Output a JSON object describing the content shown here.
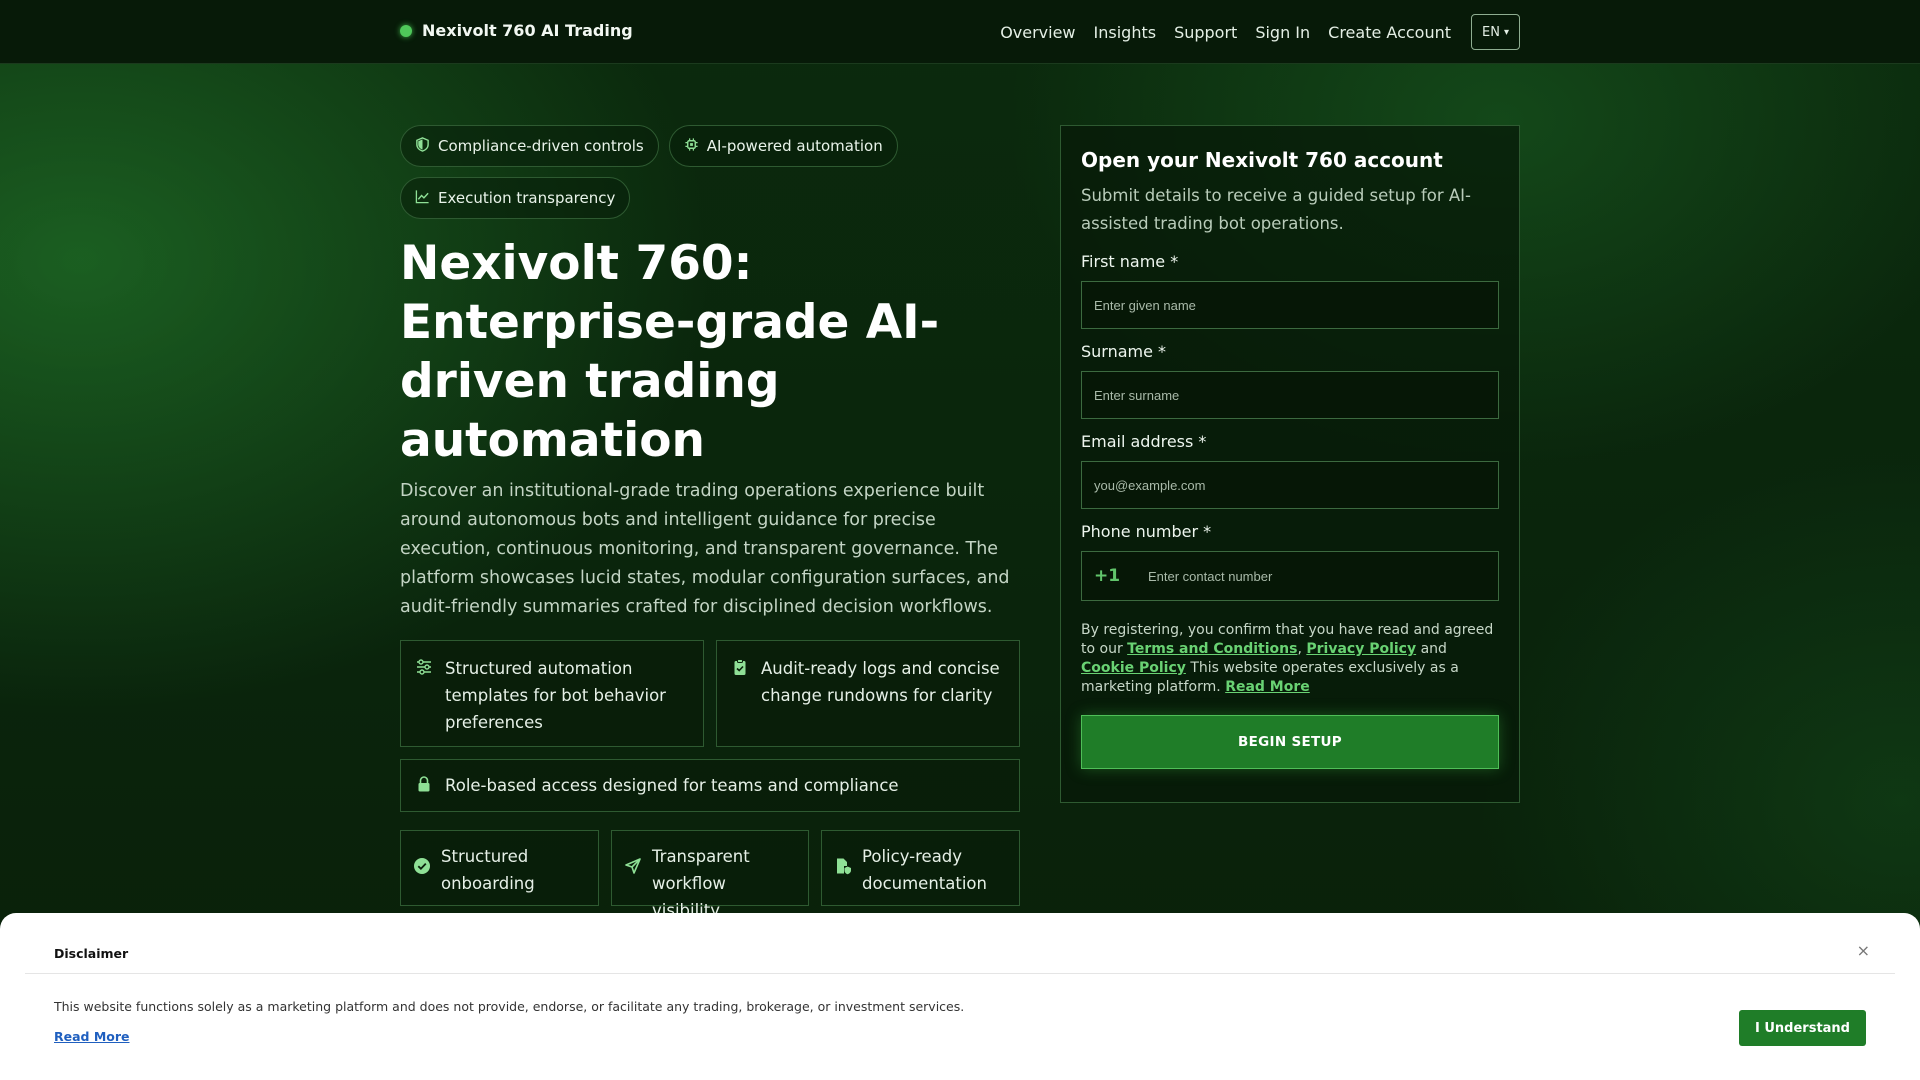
{
  "header": {
    "brand": "Nexivolt 760 AI Trading",
    "nav": [
      "Overview",
      "Insights",
      "Support",
      "Sign In",
      "Create Account"
    ],
    "language": "EN",
    "language_caret": "▾"
  },
  "hero": {
    "pills": [
      "Compliance-driven controls",
      "AI-powered automation",
      "Execution transparency"
    ],
    "title": "Nexivolt 760: Enterprise-grade AI-driven trading automation",
    "description": "Discover an institutional-grade trading operations experience built around autonomous bots and intelligent guidance for precise execution, continuous monitoring, and transparent governance. The platform showcases lucid states, modular configuration surfaces, and audit-friendly summaries crafted for disciplined decision workflows.",
    "features": [
      "Structured automation templates for bot behavior preferences",
      "Audit-ready logs and concise change rundowns for clarity",
      "Role-based access designed for teams and compliance"
    ],
    "mini_features": [
      "Structured onboarding",
      "Transparent workflow visibility",
      "Policy-ready documentation"
    ]
  },
  "form": {
    "title": "Open your Nexivolt 760 account",
    "subtitle": "Submit details to receive a guided setup for AI-assisted trading bot operations.",
    "first_name_label": "First name *",
    "first_name_placeholder": "Enter given name",
    "surname_label": "Surname *",
    "surname_placeholder": "Enter surname",
    "email_label": "Email address *",
    "email_placeholder": "you@example.com",
    "phone_label": "Phone number *",
    "phone_code": "+1",
    "phone_placeholder": "Enter contact number",
    "legal_prefix": "By registering, you confirm that you have read and agreed to our",
    "terms_link": "Terms and Conditions",
    "comma": ",",
    "privacy_link": "Privacy Policy",
    "and_word": "and",
    "cookie_link": "Cookie Policy",
    "legal_suffix": "This website operates exclusively as a marketing platform.",
    "read_more_link": "Read More",
    "submit": "BEGIN SETUP"
  },
  "disclaimer": {
    "title": "Disclaimer",
    "close": "×",
    "text": "This website functions solely as a marketing platform and does not provide, endorse, or facilitate any trading, brokerage, or investment services.",
    "read_more": "Read More",
    "button": "I Understand"
  },
  "colors": {
    "accent": "#1f7d28",
    "link_green": "#69d273",
    "brand_dot": "#4fc75a"
  }
}
